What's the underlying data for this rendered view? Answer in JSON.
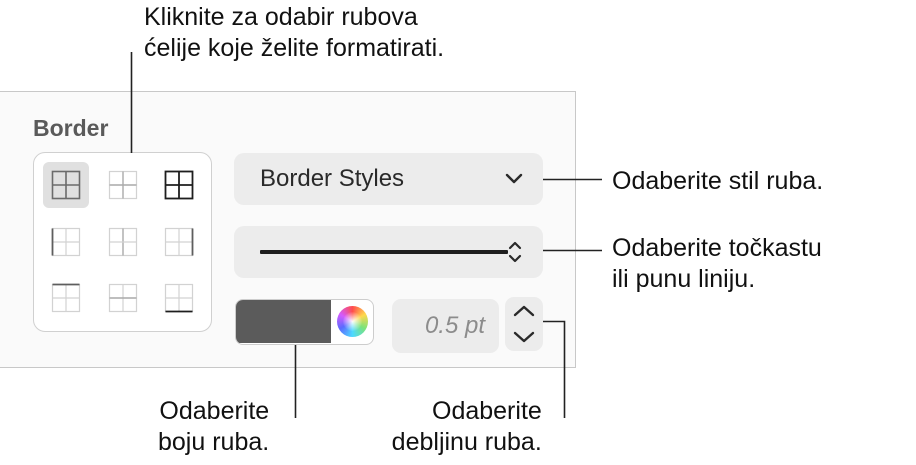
{
  "callouts": {
    "select_borders": [
      "Kliknite za odabir rubova",
      "ćelije koje želite formatirati."
    ],
    "choose_style": [
      "Odaberite stil ruba."
    ],
    "dotted_or_solid": [
      "Odaberite točkastu",
      "ili punu liniju."
    ],
    "border_color": [
      "Odaberite",
      "boju ruba."
    ],
    "border_width": [
      "Odaberite",
      "debljinu ruba."
    ]
  },
  "panel": {
    "section_title": "Border",
    "border_options": [
      {
        "icon": "all-borders-icon",
        "selected": true
      },
      {
        "icon": "inside-borders-icon",
        "selected": false
      },
      {
        "icon": "grid-borders-icon",
        "selected": false
      },
      {
        "icon": "left-border-icon",
        "selected": false
      },
      {
        "icon": "inside-vertical-border-icon",
        "selected": false
      },
      {
        "icon": "right-border-icon",
        "selected": false
      },
      {
        "icon": "top-border-icon",
        "selected": false
      },
      {
        "icon": "inside-horizontal-border-icon",
        "selected": false
      },
      {
        "icon": "bottom-border-icon",
        "selected": false
      }
    ],
    "styles_popup_label": "Border Styles",
    "line_popup": {
      "style": "solid"
    },
    "color": {
      "value": "#5b5b5b"
    },
    "width_value": "0.5 pt"
  },
  "colors": {
    "panel_bg": "#fafafa",
    "control_bg": "#ececec",
    "selected_bg": "#e0e0e0",
    "text": "#1d1d1f",
    "muted_text": "#8c8c8c"
  }
}
